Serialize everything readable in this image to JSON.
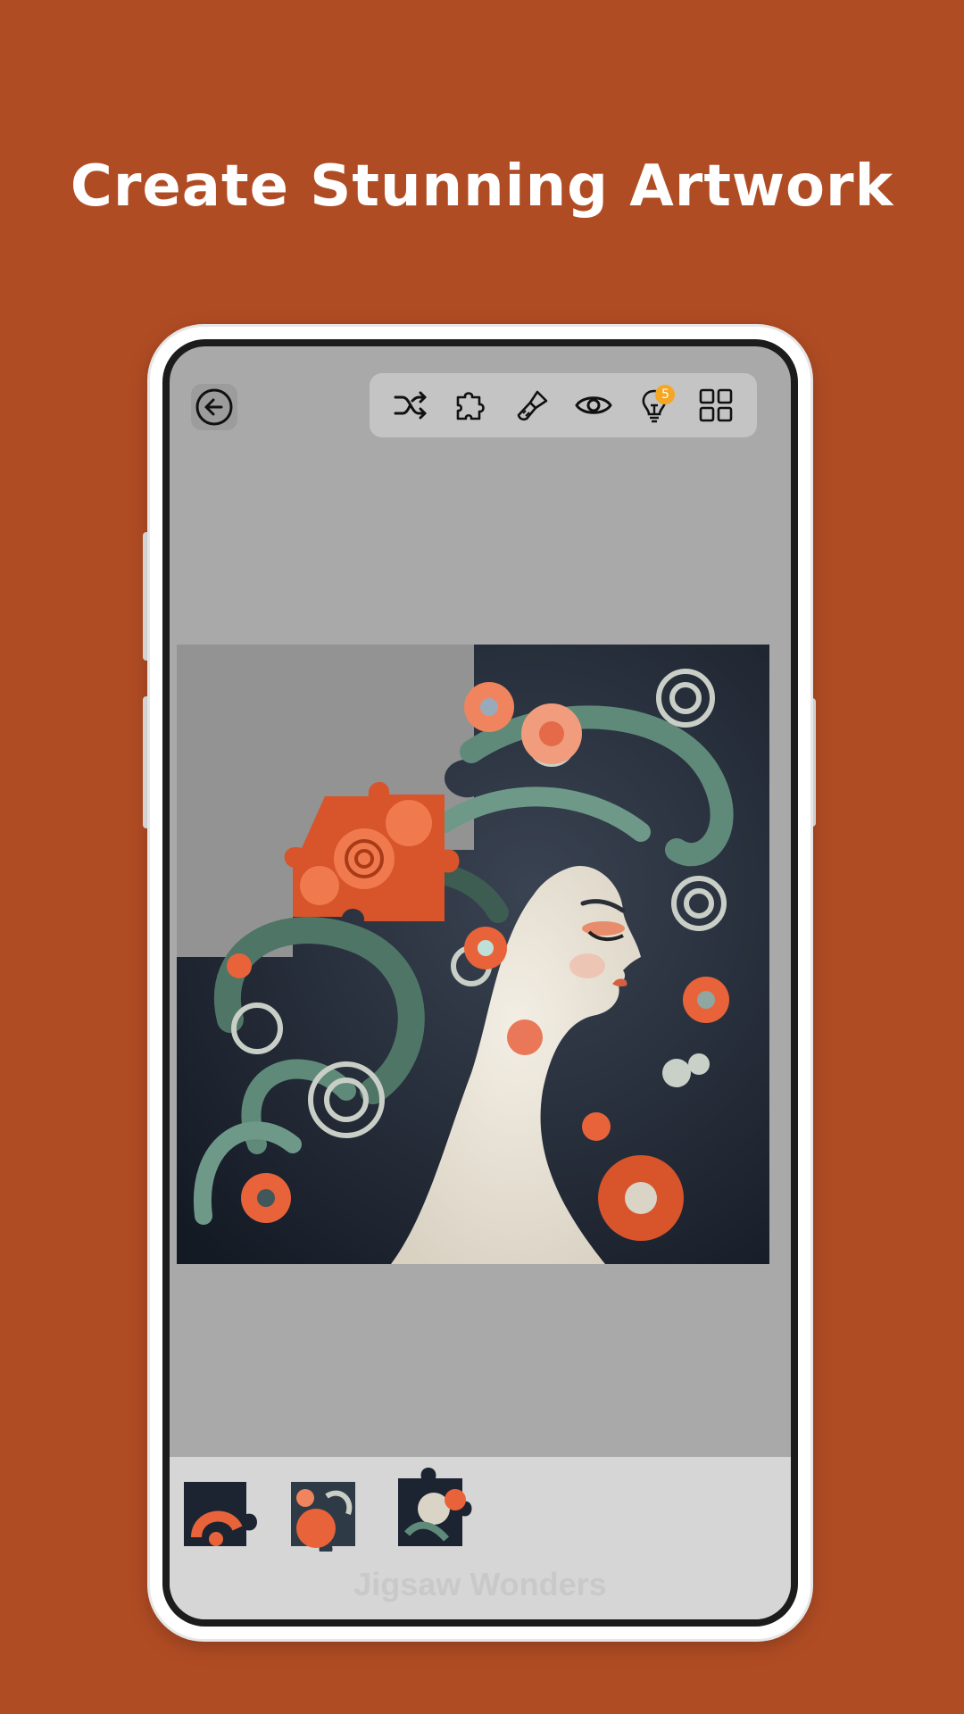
{
  "headline": "Create Stunning Artwork",
  "watermark": "Jigsaw Wonders",
  "toolbar": {
    "tools": [
      {
        "icon": "shuffle-icon"
      },
      {
        "icon": "puzzle-piece-icon"
      },
      {
        "icon": "brush-icon"
      },
      {
        "icon": "eye-icon"
      },
      {
        "icon": "hint-bulb-icon",
        "badge": "5"
      },
      {
        "icon": "grid-icon"
      }
    ]
  },
  "colors": {
    "background": "#b04c24",
    "screen": "#a9a9a9",
    "board_empty": "#939393",
    "tray": "#d6d6d6",
    "badge": "#f5a623"
  },
  "tray_pieces": 3
}
